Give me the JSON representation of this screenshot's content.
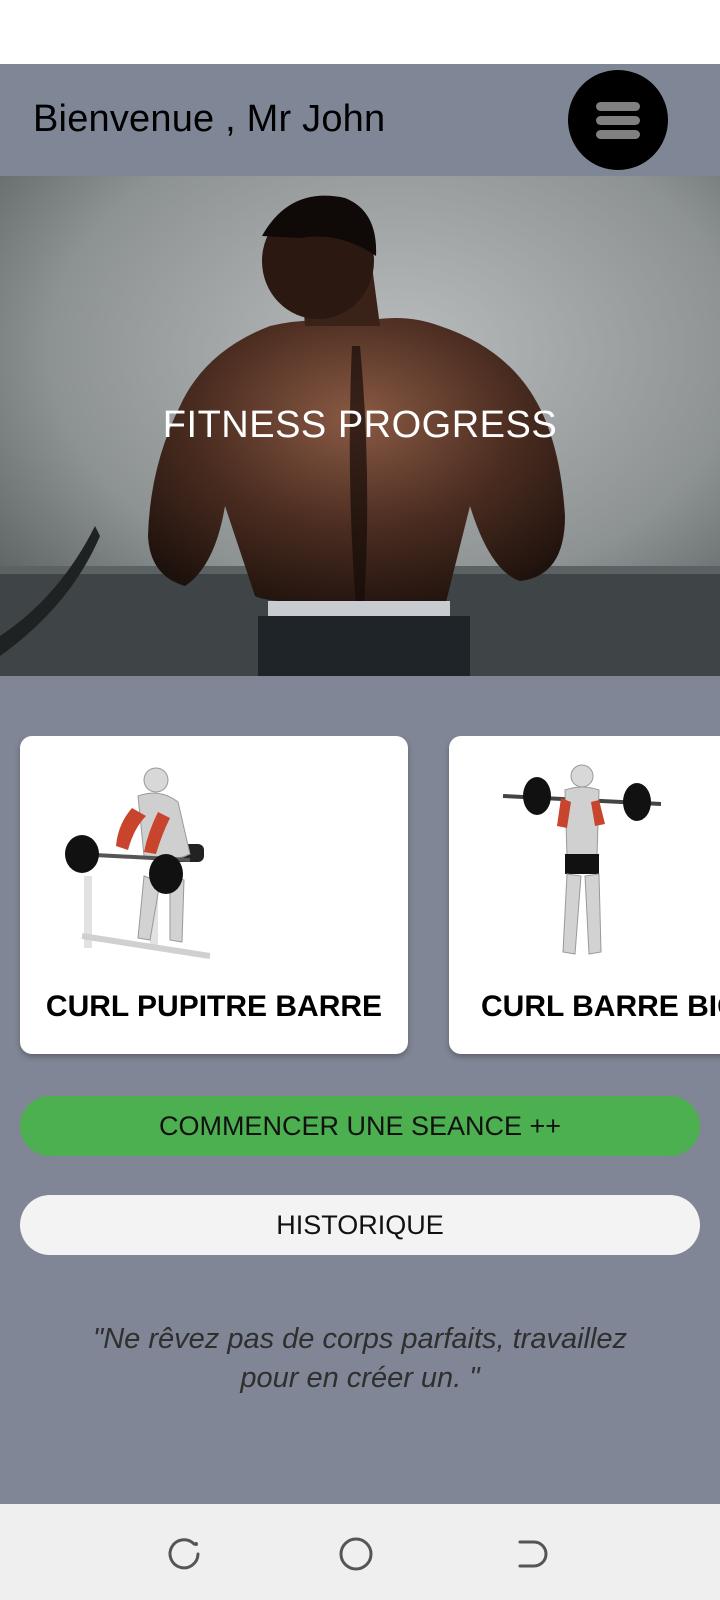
{
  "header": {
    "title": "Bienvenue , Mr John",
    "menu_icon": "hamburger-menu-icon"
  },
  "hero": {
    "title": "FITNESS PROGRESS"
  },
  "exercises": [
    {
      "label": "CURL PUPITRE BARRE"
    },
    {
      "label": "CURL BARRE BIC"
    }
  ],
  "actions": {
    "start_label": "COMMENCER UNE SEANCE ++",
    "history_label": "HISTORIQUE"
  },
  "quote": "\"Ne rêvez pas de corps parfaits, travaillez pour en créer un. \"",
  "nav": {
    "recents_icon": "recents-icon",
    "home_icon": "home-circle-icon",
    "back_icon": "back-icon"
  },
  "colors": {
    "app_background": "#808695",
    "start_button": "#4caf50",
    "history_button": "#f3f3f3",
    "muscle_highlight": "#c9442d"
  }
}
